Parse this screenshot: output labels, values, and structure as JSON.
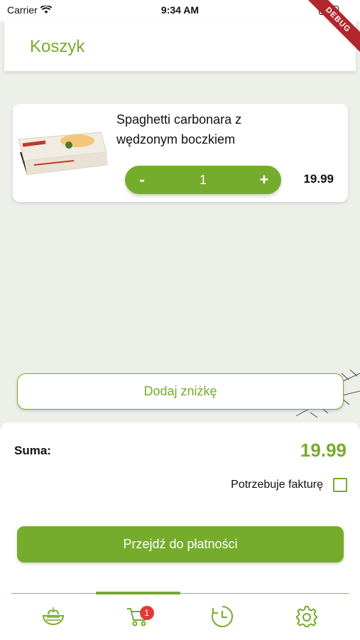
{
  "status_bar": {
    "carrier": "Carrier",
    "time": "9:34 AM"
  },
  "debug_banner": "DEBUG",
  "header": {
    "title": "Koszyk"
  },
  "cart": {
    "items": [
      {
        "name": "Spaghetti carbonara z wędzonym boczkiem",
        "quantity": "1",
        "price": "19.99",
        "decrement": "-",
        "increment": "+"
      }
    ]
  },
  "discount_button": "Dodaj zniżkę",
  "summary": {
    "sum_label": "Suma:",
    "sum_value": "19.99",
    "invoice_label": "Potrzebuje fakturę",
    "invoice_checked": false,
    "checkout_button": "Przejdź do płatności"
  },
  "bottom_nav": {
    "items": [
      {
        "icon": "food-bowl-icon",
        "active": false
      },
      {
        "icon": "cart-icon",
        "active": true,
        "badge": "1"
      },
      {
        "icon": "history-clock-icon",
        "active": false
      },
      {
        "icon": "gear-icon",
        "active": false
      }
    ]
  },
  "colors": {
    "accent": "#76ac2b",
    "badge": "#e53935",
    "debug": "#b3262b",
    "background": "#edefe9"
  }
}
